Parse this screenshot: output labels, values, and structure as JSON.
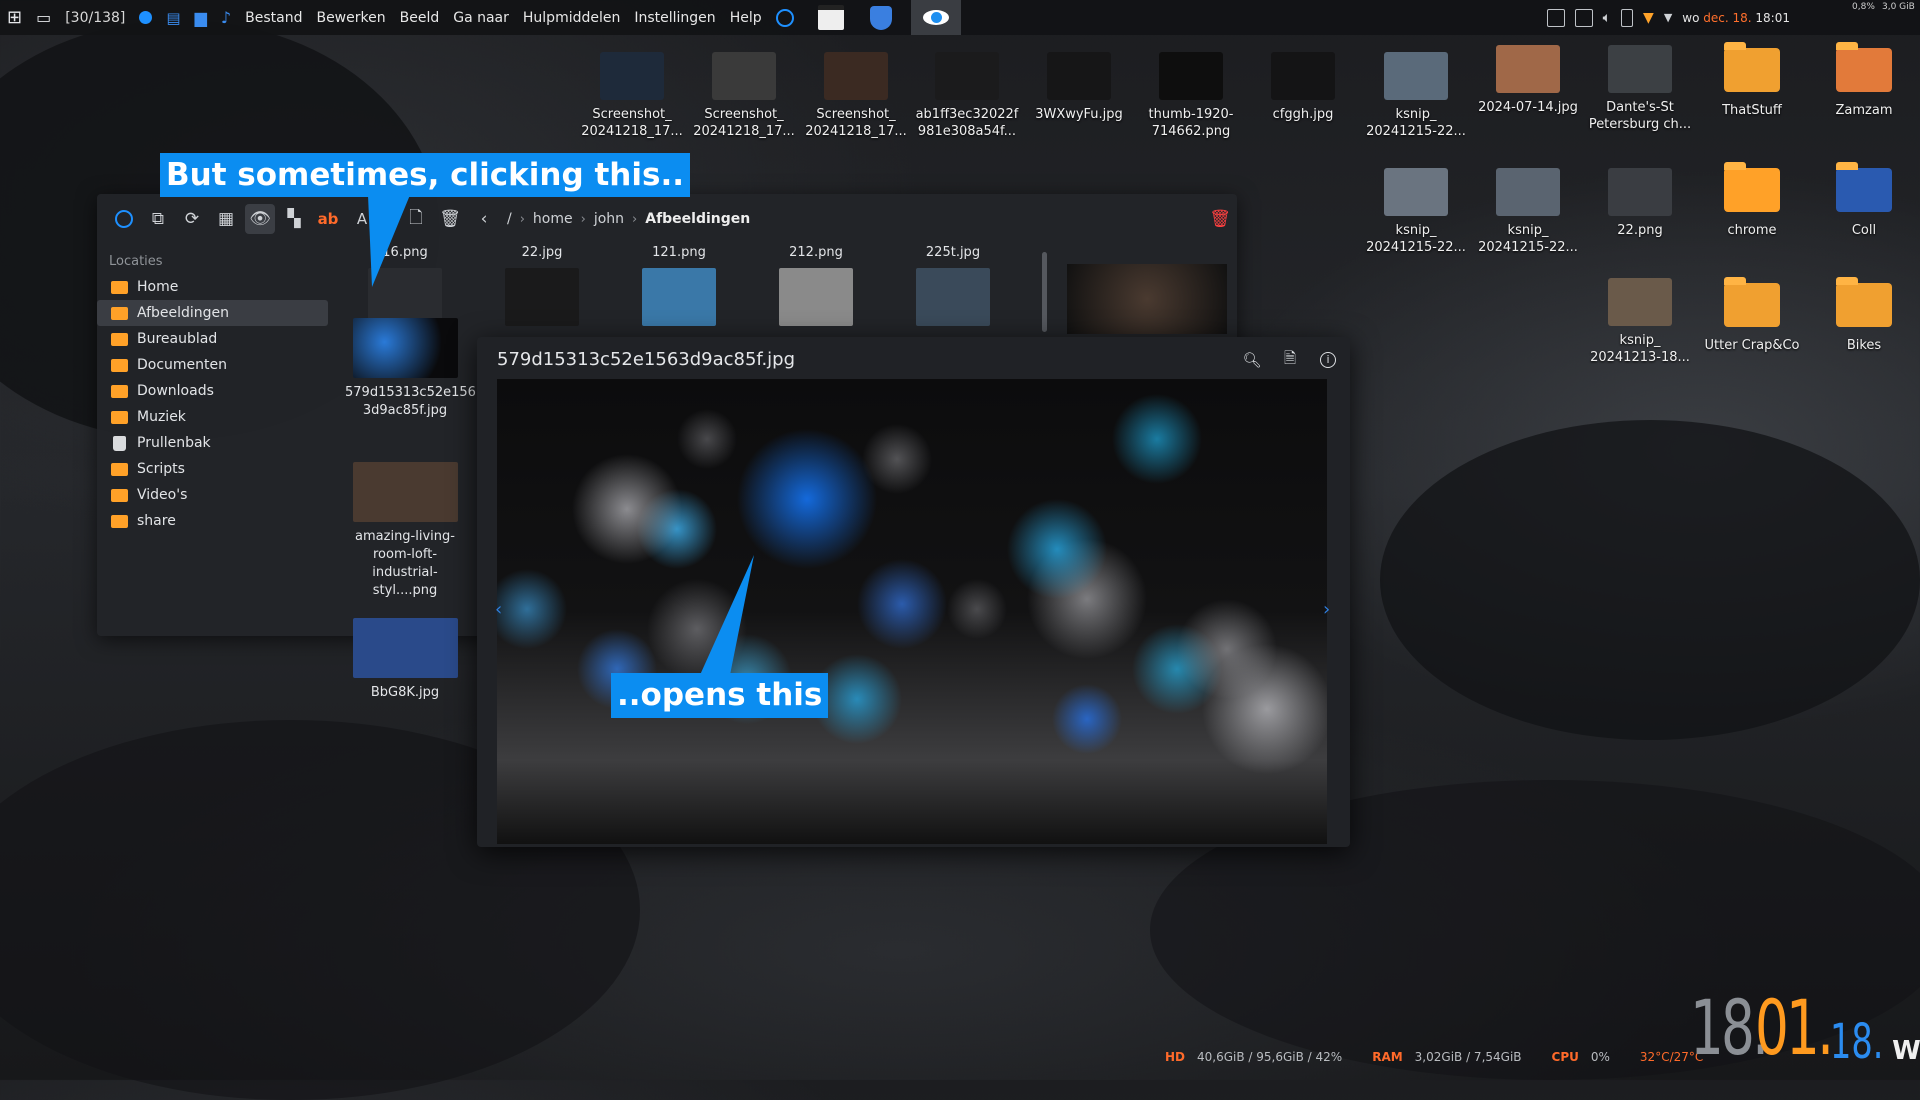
{
  "top_panel": {
    "counter": "[30/138]",
    "menu": [
      "Bestand",
      "Bewerken",
      "Beeld",
      "Ga naar",
      "Hulpmiddelen",
      "Instellingen",
      "Help"
    ],
    "clock_day": "wo",
    "clock_date": "dec. 18.",
    "clock_time": "18:01",
    "meter_cpu": "0,8%",
    "meter_mem": "3,0 GiB"
  },
  "desktop_icons": [
    {
      "label": "Screenshot_ 20241218_17...",
      "color": "#1e2a3a"
    },
    {
      "label": "Screenshot_ 20241218_17...",
      "color": "#3a3a3a"
    },
    {
      "label": "Screenshot_ 20241218_17...",
      "color": "#3b2a22"
    },
    {
      "label": "ab1ff3ec32022f 981e308a54f...",
      "color": "#1b1b1c"
    },
    {
      "label": "3WXwyFu.jpg",
      "color": "#161617"
    },
    {
      "label": "thumb-1920- 714662.png",
      "color": "#0e0e0e"
    },
    {
      "label": "cfggh.jpg",
      "color": "#141415"
    },
    {
      "label": "ksnip_ 20241215-22...",
      "color": "#5a6a7a"
    },
    {
      "label": "2024-07-14.jpg",
      "color": "#a06848"
    },
    {
      "label": "Dante's-St Petersburg ch...",
      "color": "#3c4044"
    },
    {
      "label": "ThatStuff",
      "color": "#f0a030"
    },
    {
      "label": "Zamzam",
      "color": "#e27a3a"
    },
    {
      "label": "ksnip_ 20241215-22...",
      "color": "#6a7480"
    },
    {
      "label": "ksnip_ 20241215-22...",
      "color": "#5a6470"
    },
    {
      "label": "22.png",
      "color": "#3a3d42"
    },
    {
      "label": "chrome",
      "color": "#ffa128"
    },
    {
      "label": "Coll",
      "color": "#2a5ab0"
    },
    {
      "label": "ksnip_ 20241213-18...",
      "color": "#6a5a4a"
    },
    {
      "label": "Utter Crap&Co",
      "color": "#f0a030"
    },
    {
      "label": "Bikes",
      "color": "#f0a030"
    }
  ],
  "file_manager": {
    "breadcrumb": [
      "/",
      "home",
      "john",
      "Afbeeldingen"
    ],
    "sidebar_title": "Locaties",
    "sidebar_items": [
      "Home",
      "Afbeeldingen",
      "Bureaublad",
      "Documenten",
      "Downloads",
      "Muziek",
      "Prullenbak",
      "Scripts",
      "Video's",
      "share"
    ],
    "files": [
      {
        "label": "16.png",
        "color": "#2a2c30"
      },
      {
        "label": "22.jpg",
        "color": "#1a1a1b"
      },
      {
        "label": "121.png",
        "color": "#3a78a8"
      },
      {
        "label": "212.png",
        "color": "#8a8a8a"
      },
      {
        "label": "225t.jpg",
        "color": "#3a4a5a"
      },
      {
        "label": "579d15313c52e156 3d9ac85f.jpg",
        "color": "#1b3a6a"
      },
      {
        "label": "amazing-living-room-loft-industrial-styl....png",
        "color": "#4a3a30"
      },
      {
        "label": "BbG8K.jpg",
        "color": "#2a4a8a"
      }
    ]
  },
  "viewer": {
    "title": "579d15313c52e1563d9ac85f.jpg",
    "zoom_icon": "zoom-icon",
    "open_icon": "open-file-icon",
    "info_icon": "info-icon"
  },
  "callouts": {
    "top": "But sometimes, clicking this..",
    "bottom": "..opens this",
    "color": "#0b8df1"
  },
  "stats": {
    "hd_label": "HD",
    "hd_value": "40,6GiB / 95,6GiB / 42%",
    "ram_label": "RAM",
    "ram_value": "3,02GiB / 7,54GiB",
    "cpu_label": "CPU",
    "cpu_value": "0%",
    "temp_value": "32°C/27°C"
  },
  "big_clock": {
    "day": "18.",
    "month": "01.",
    "year": "18.",
    "weekday": "WO"
  }
}
